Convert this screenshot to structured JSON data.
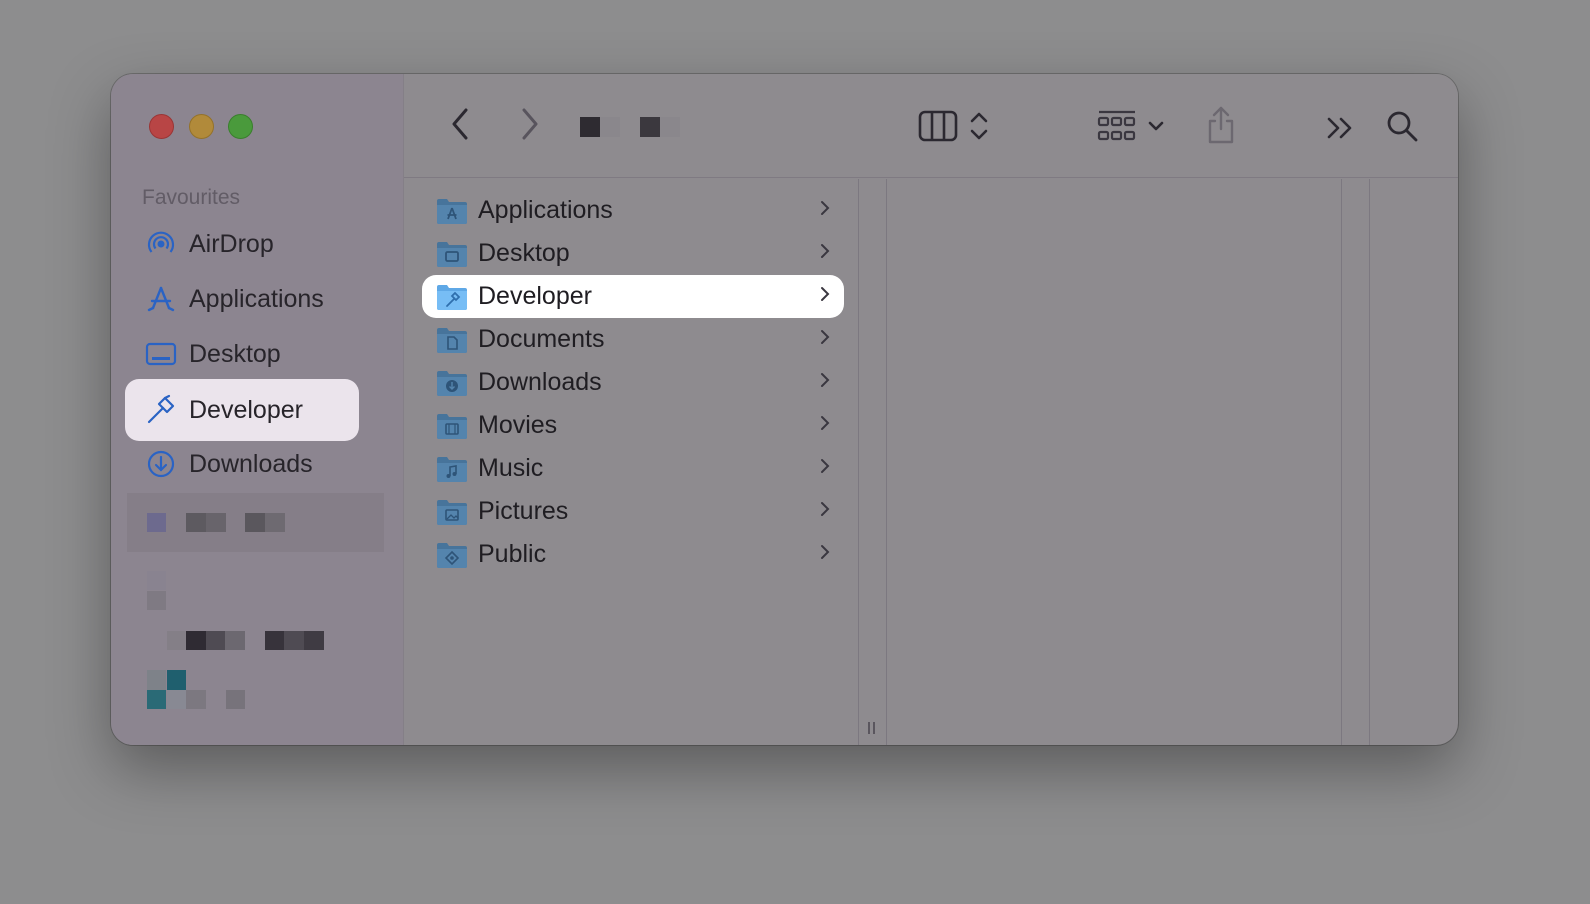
{
  "sidebar": {
    "section_title": "Favourites",
    "items": [
      {
        "label": "AirDrop",
        "icon": "airdrop-icon"
      },
      {
        "label": "Applications",
        "icon": "applications-icon"
      },
      {
        "label": "Desktop",
        "icon": "desktop-icon"
      },
      {
        "label": "Developer",
        "icon": "hammer-icon",
        "selected": true
      },
      {
        "label": "Downloads",
        "icon": "downloads-icon"
      }
    ]
  },
  "toolbar": {
    "icons": [
      "back-icon",
      "forward-icon",
      "column-view-icon",
      "group-icon",
      "share-icon",
      "more-icon",
      "search-icon"
    ]
  },
  "browser": {
    "items": [
      {
        "label": "Applications",
        "icon": "applications-folder-icon"
      },
      {
        "label": "Desktop",
        "icon": "desktop-folder-icon"
      },
      {
        "label": "Developer",
        "icon": "developer-folder-icon",
        "selected": true
      },
      {
        "label": "Documents",
        "icon": "documents-folder-icon"
      },
      {
        "label": "Downloads",
        "icon": "downloads-folder-icon"
      },
      {
        "label": "Movies",
        "icon": "movies-folder-icon"
      },
      {
        "label": "Music",
        "icon": "music-folder-icon"
      },
      {
        "label": "Pictures",
        "icon": "pictures-folder-icon"
      },
      {
        "label": "Public",
        "icon": "public-folder-icon"
      }
    ]
  },
  "colors": {
    "accent": "#2b6fd6",
    "selection": "#ffffff",
    "sidebar_selection": "#ebe4ec"
  }
}
